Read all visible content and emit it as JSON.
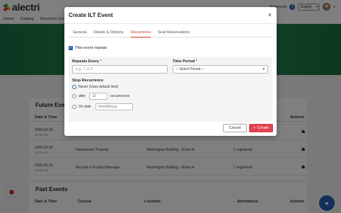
{
  "app": {
    "brand": "alectri"
  },
  "topbar": {
    "approvals_label": "Approvals",
    "approvals_count": "1",
    "language": "English",
    "language_caret": "▾",
    "avatar_caret": "▾"
  },
  "nav": {
    "items": [
      "Home",
      "Catalog",
      "Discovery Center"
    ]
  },
  "future_events": {
    "title": "Future Events",
    "headers": {
      "datetime": "Date & Time",
      "actions": "Actions"
    },
    "rows": [
      {
        "date": "2026-04-20",
        "time": "10:00 AM",
        "course": "",
        "location": "",
        "attendance": "",
        "visible_title": false
      },
      {
        "date": "2026-04-20",
        "time": "10:00 AM",
        "course": "Harassment Training",
        "location": "Washington Building - Room A",
        "attendance": "1 registered"
      },
      {
        "date": "2026-06-16",
        "time": "10:00 AM",
        "course": "Become a Product Manager",
        "location": "Washington Building - Room A",
        "attendance": "7 registered"
      }
    ]
  },
  "past_events": {
    "title": "Past Events",
    "headers": {
      "datetime": "Date & Time",
      "course": "Course",
      "location": "Location",
      "attendance": "Attendance",
      "actions": "Actions"
    }
  },
  "modal": {
    "title": "Create ILT Event",
    "close": "×",
    "tabs": [
      "General",
      "Details & Options",
      "Recurrence",
      "Seat Reservations"
    ],
    "active_tab": "Recurrence",
    "repeats_label": "This event repeats",
    "repeats_checked": true,
    "repeats_every_label": "Repeats Every",
    "repeats_every_required": "*",
    "repeats_every_placeholder": "e.g., 1 or 2",
    "time_period_label": "Time Period",
    "time_period_required": "*",
    "time_period_value": "-- Select Period --",
    "time_period_caret": "▾",
    "stop_label": "Stop Recurrence",
    "stop_options": {
      "never": "Never (Uses default limit)",
      "after": "after",
      "after_value": "10",
      "after_suffix": "occurrences",
      "on_date": "On date",
      "date_placeholder": "mm/dd/yyyy"
    },
    "selected_stop": "never",
    "cancel_label": "Cancel",
    "create_label": "Create",
    "create_icon": "+"
  },
  "colors": {
    "accent": "#c0392b",
    "primary": "#2b5fb8",
    "create": "#e04350",
    "hero": "#1d7a4a"
  }
}
